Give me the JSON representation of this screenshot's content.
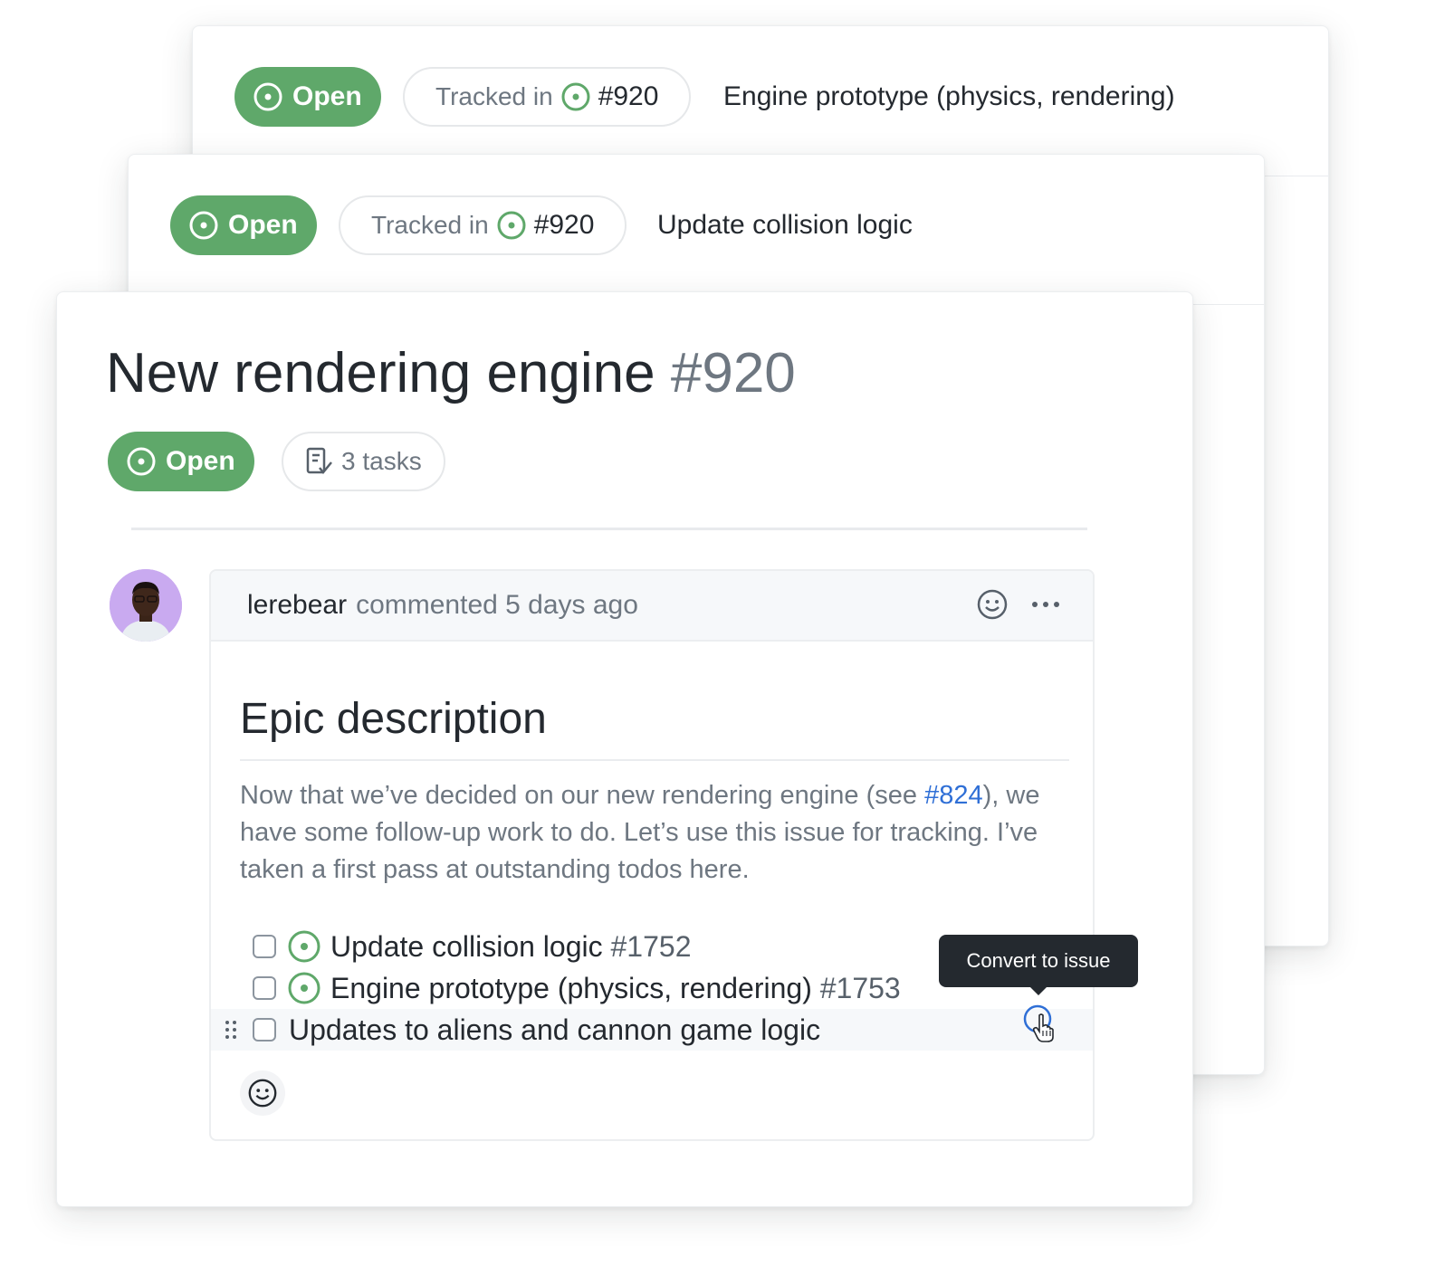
{
  "back_card": {
    "status_label": "Open",
    "tracked_prefix": "Tracked in",
    "tracked_number": "#920",
    "title": "Engine prototype (physics, rendering)"
  },
  "mid_card": {
    "status_label": "Open",
    "tracked_prefix": "Tracked in",
    "tracked_number": "#920",
    "title": "Update collision logic"
  },
  "issue": {
    "title": "New rendering engine",
    "number": "#920",
    "status_label": "Open",
    "tasks_label": "3 tasks"
  },
  "comment": {
    "author": "lerebear",
    "meta": "commented 5 days ago",
    "heading": "Epic description",
    "body_before_link": "Now that we’ve decided on our new rendering engine (see ",
    "body_link": "#824",
    "body_after_link": "), we have some follow-up work to do. Let’s use this issue for tracking. I’ve taken a first pass at outstanding todos here.",
    "tasks": [
      {
        "title": "Update collision logic",
        "number": "#1752",
        "checked": false,
        "is_issue": true
      },
      {
        "title": "Engine prototype (physics, rendering)",
        "number": "#1753",
        "checked": false,
        "is_issue": true
      },
      {
        "title": "Updates to aliens and cannon game logic",
        "number": "",
        "checked": false,
        "is_issue": false
      }
    ],
    "tooltip": "Convert to issue"
  },
  "colors": {
    "open_green": "#5fa86a",
    "link_blue": "#2f6fd6",
    "tooltip_bg": "#24292f"
  },
  "icons": [
    "issue-opened-icon",
    "tasklist-icon",
    "smiley-icon",
    "kebab-horizontal-icon",
    "grabber-icon",
    "pointer-hand-icon"
  ]
}
